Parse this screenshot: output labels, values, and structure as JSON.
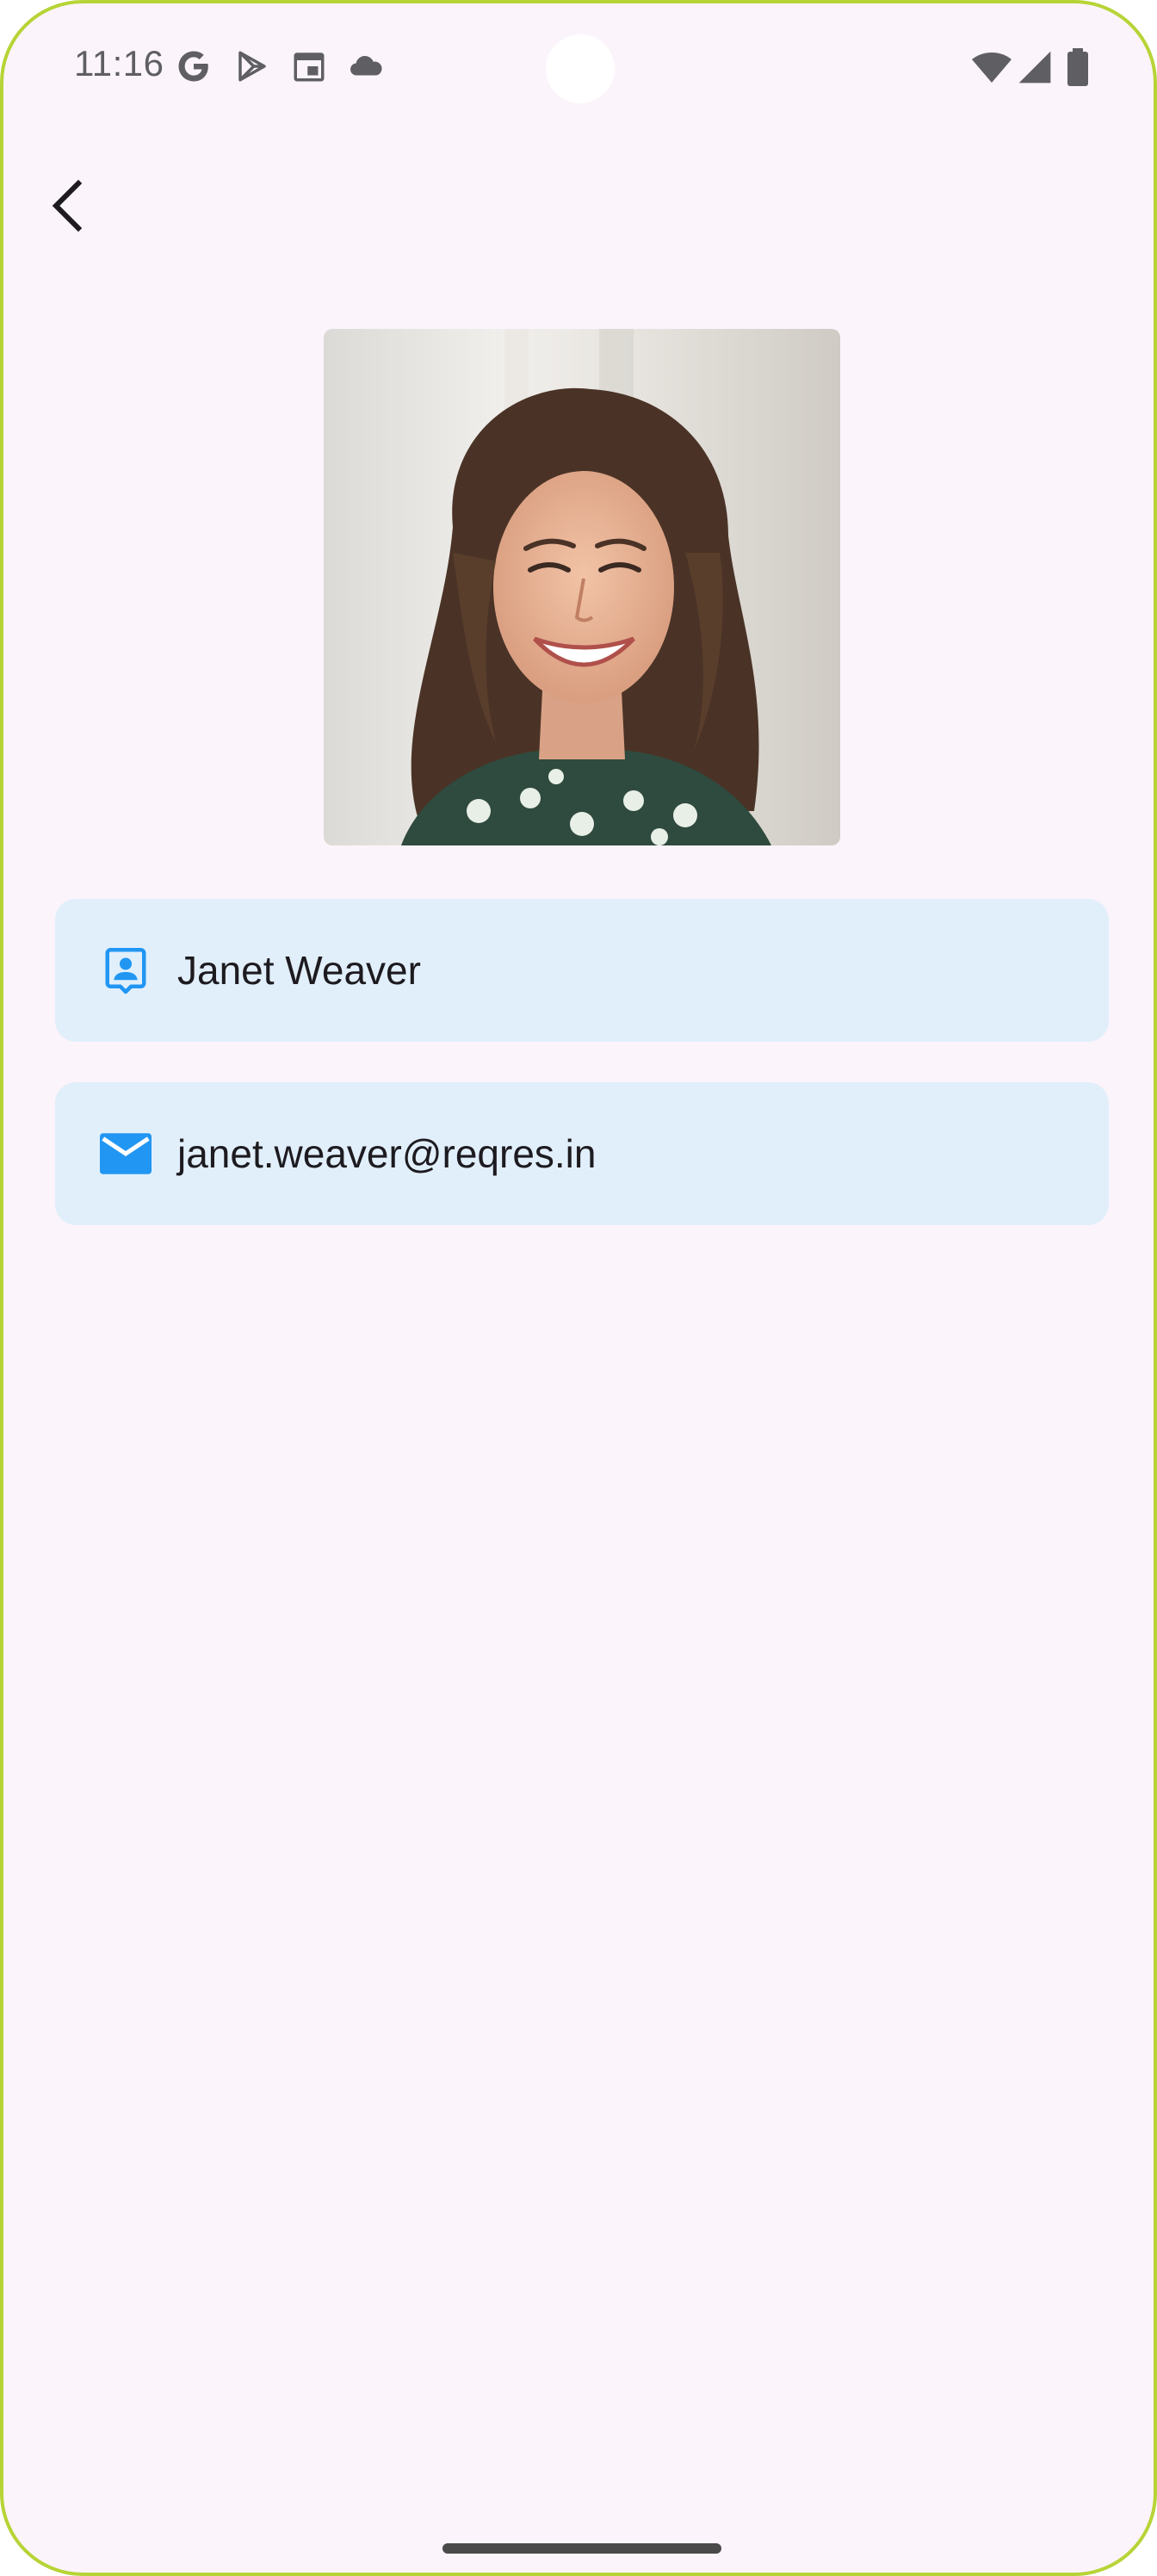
{
  "status_bar": {
    "time": "11:16",
    "left_icons": [
      "google-g-icon",
      "play-store-icon",
      "calendar-icon",
      "cloud-icon"
    ],
    "right_icons": [
      "wifi-icon",
      "cellular-signal-icon",
      "battery-icon"
    ]
  },
  "header": {
    "back_icon": "chevron-left-icon"
  },
  "profile": {
    "avatar_alt": "user-photo",
    "name": "Janet Weaver",
    "email": "janet.weaver@reqres.in"
  },
  "colors": {
    "background": "#fcf4fb",
    "card_bg": "#e1effb",
    "accent": "#2196f3",
    "text": "#1d1b20",
    "frame": "#b7d437"
  }
}
